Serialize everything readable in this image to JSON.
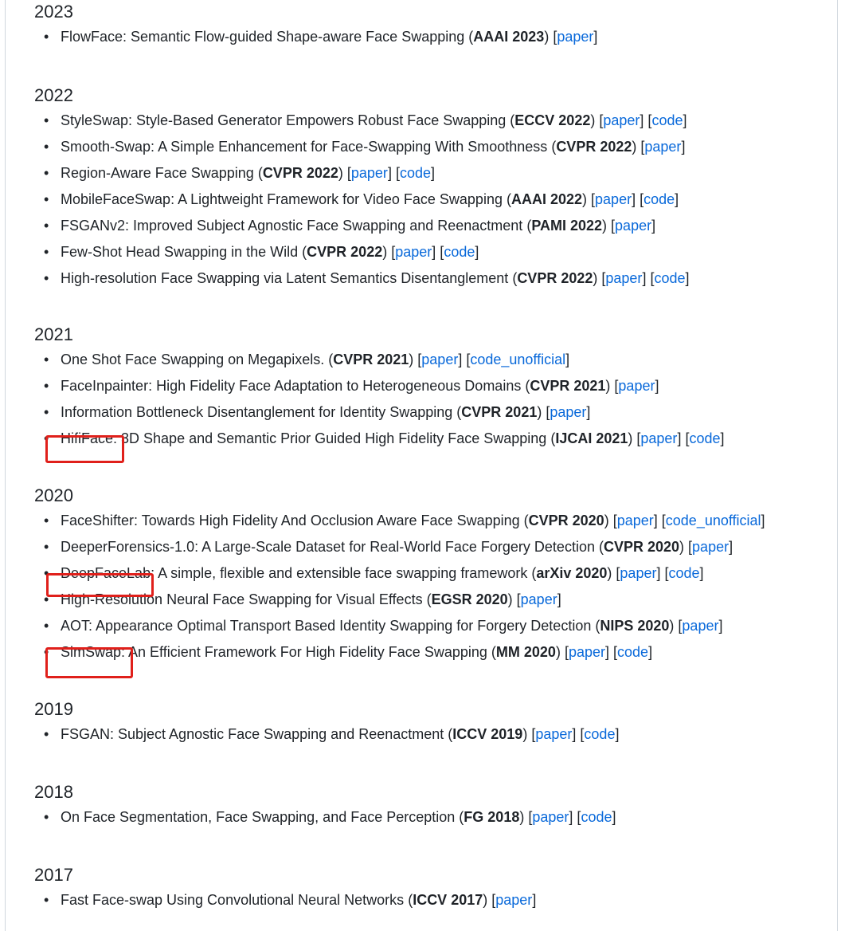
{
  "sections": [
    {
      "year": "2023",
      "items": [
        {
          "title": "FlowFace: Semantic Flow-guided Shape-aware Face Swapping",
          "venue": "AAAI 2023",
          "links": [
            "paper"
          ]
        }
      ]
    },
    {
      "year": "2022",
      "items": [
        {
          "title": "StyleSwap: Style-Based Generator Empowers Robust Face Swapping",
          "venue": "ECCV 2022",
          "links": [
            "paper",
            "code"
          ]
        },
        {
          "title": "Smooth-Swap: A Simple Enhancement for Face-Swapping With Smoothness",
          "venue": "CVPR 2022",
          "links": [
            "paper"
          ]
        },
        {
          "title": "Region-Aware Face Swapping",
          "venue": "CVPR 2022",
          "links": [
            "paper",
            "code"
          ]
        },
        {
          "title": "MobileFaceSwap: A Lightweight Framework for Video Face Swapping",
          "venue": "AAAI 2022",
          "links": [
            "paper",
            "code"
          ]
        },
        {
          "title": "FSGANv2: Improved Subject Agnostic Face Swapping and Reenactment",
          "venue": "PAMI 2022",
          "links": [
            "paper"
          ]
        },
        {
          "title": "Few-Shot Head Swapping in the Wild",
          "venue": "CVPR 2022",
          "links": [
            "paper",
            "code"
          ]
        },
        {
          "title": "High-resolution Face Swapping via Latent Semantics Disentanglement",
          "venue": "CVPR 2022",
          "links": [
            "paper",
            "code"
          ]
        }
      ]
    },
    {
      "year": "2021",
      "items": [
        {
          "title": "One Shot Face Swapping on Megapixels.",
          "venue": "CVPR 2021",
          "links": [
            "paper",
            "code_unofficial"
          ]
        },
        {
          "title": "FaceInpainter: High Fidelity Face Adaptation to Heterogeneous Domains",
          "venue": "CVPR 2021",
          "links": [
            "paper"
          ]
        },
        {
          "title": "Information Bottleneck Disentanglement for Identity Swapping",
          "venue": "CVPR 2021",
          "links": [
            "paper"
          ]
        },
        {
          "title": "HifiFace: 3D Shape and Semantic Prior Guided High Fidelity Face Swapping",
          "venue": "IJCAI 2021",
          "links": [
            "paper",
            "code"
          ],
          "highlight": true
        }
      ]
    },
    {
      "year": "2020",
      "items": [
        {
          "title": "FaceShifter: Towards High Fidelity And Occlusion Aware Face Swapping",
          "venue": "CVPR 2020",
          "links": [
            "paper",
            "code_unofficial"
          ]
        },
        {
          "title": "DeeperForensics-1.0: A Large-Scale Dataset for Real-World Face Forgery Detection",
          "venue": "CVPR 2020",
          "links": [
            "paper"
          ]
        },
        {
          "title": "DeepFaceLab: A simple, flexible and extensible face swapping framework",
          "venue": "arXiv 2020",
          "links": [
            "paper",
            "code"
          ],
          "highlight": true
        },
        {
          "title": "High-Resolution Neural Face Swapping for Visual Effects",
          "venue": "EGSR 2020",
          "links": [
            "paper"
          ]
        },
        {
          "title": "AOT: Appearance Optimal Transport Based Identity Swapping for Forgery Detection",
          "venue": "NIPS 2020",
          "links": [
            "paper"
          ]
        },
        {
          "title": "SimSwap: An Efficient Framework For High Fidelity Face Swapping",
          "venue": "MM 2020",
          "links": [
            "paper",
            "code"
          ],
          "highlight": true
        }
      ]
    },
    {
      "year": "2019",
      "items": [
        {
          "title": "FSGAN: Subject Agnostic Face Swapping and Reenactment",
          "venue": "ICCV 2019",
          "links": [
            "paper",
            "code"
          ]
        }
      ]
    },
    {
      "year": "2018",
      "items": [
        {
          "title": "On Face Segmentation, Face Swapping, and Face Perception",
          "venue": "FG 2018",
          "links": [
            "paper",
            "code"
          ]
        }
      ]
    },
    {
      "year": "2017",
      "items": [
        {
          "title": "Fast Face-swap Using Convolutional Neural Networks",
          "venue": "ICCV 2017",
          "links": [
            "paper"
          ]
        }
      ]
    }
  ],
  "colors": {
    "link": "#0969da",
    "text": "#1f2328",
    "highlight_box": "#e0201b"
  }
}
